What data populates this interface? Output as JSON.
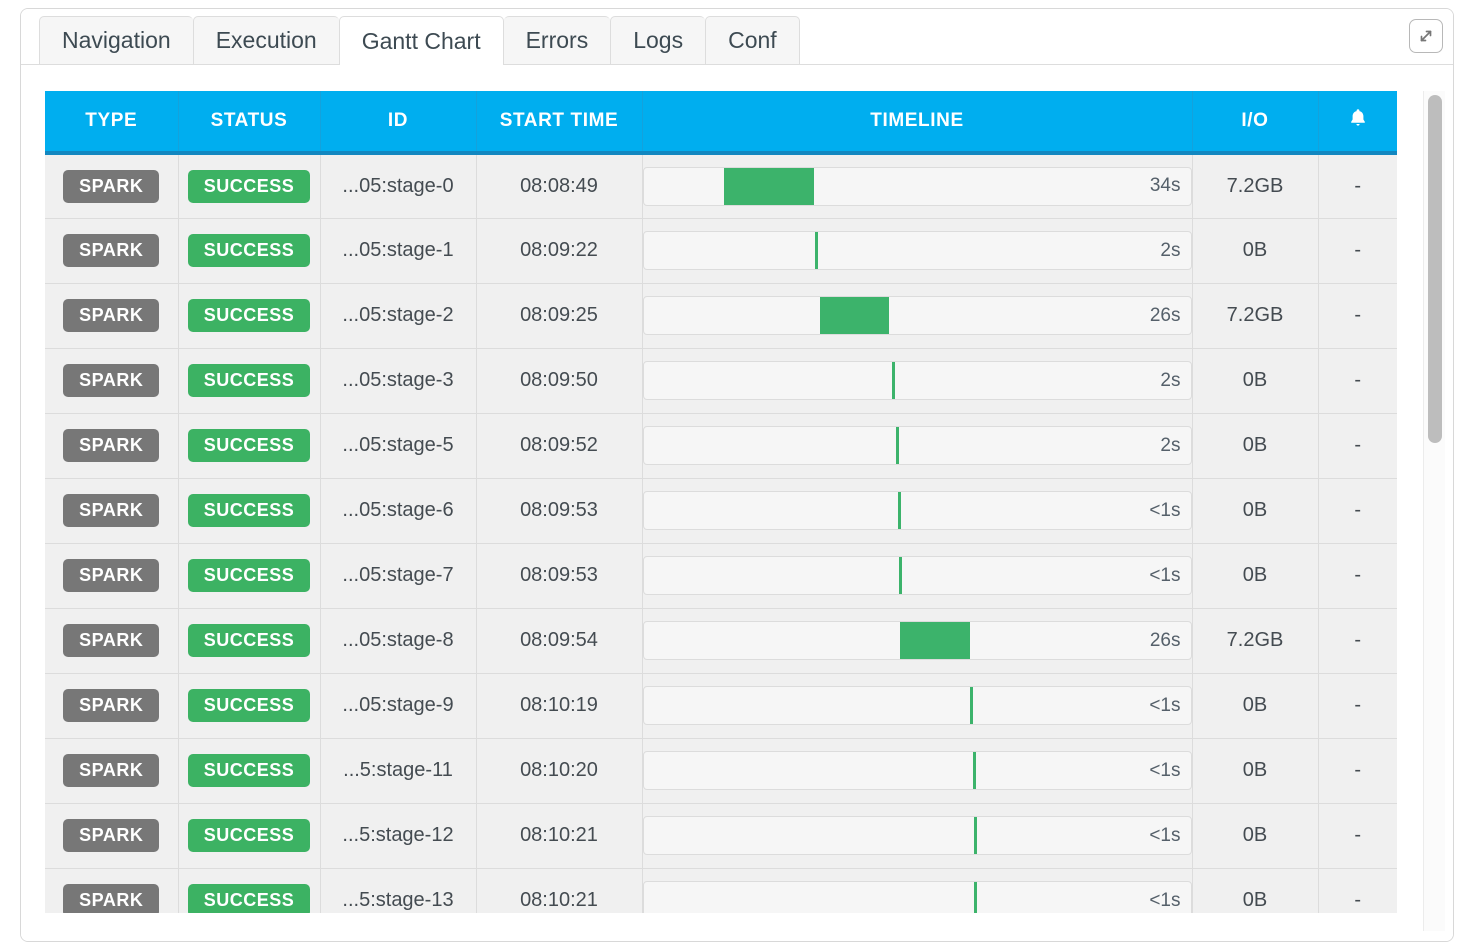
{
  "window": {
    "expand_button_label": "expand",
    "expand_icon": "resize-diagonal-icon"
  },
  "tabs": [
    {
      "label": "Navigation",
      "active": false
    },
    {
      "label": "Execution",
      "active": false
    },
    {
      "label": "Gantt Chart",
      "active": true
    },
    {
      "label": "Errors",
      "active": false
    },
    {
      "label": "Logs",
      "active": false
    },
    {
      "label": "Conf",
      "active": false
    }
  ],
  "table": {
    "columns": [
      {
        "label": "TYPE",
        "key": "type"
      },
      {
        "label": "STATUS",
        "key": "status"
      },
      {
        "label": "ID",
        "key": "id"
      },
      {
        "label": "START TIME",
        "key": "start"
      },
      {
        "label": "TIMELINE",
        "key": "timeline"
      },
      {
        "label": "I/O",
        "key": "io"
      },
      {
        "label": "",
        "key": "alert",
        "icon": "bell-icon"
      }
    ],
    "colors": {
      "header_bg": "#00aeef",
      "header_border": "#1287c0",
      "type_badge": "#777777",
      "status_badge": "#3cb263",
      "bar": "#3cb36b",
      "row_bg": "#f0f0f0",
      "track_bg": "#f6f6f6"
    },
    "rows": [
      {
        "type": "SPARK",
        "status": "SUCCESS",
        "id": "...05:stage-0",
        "start": "08:08:49",
        "duration": "34s",
        "bar_left_pct": 14.7,
        "bar_width_pct": 16.4,
        "io": "7.2GB",
        "alert": "-"
      },
      {
        "type": "SPARK",
        "status": "SUCCESS",
        "id": "...05:stage-1",
        "start": "08:09:22",
        "duration": "2s",
        "bar_left_pct": 31.3,
        "bar_width_pct": 0.55,
        "io": "0B",
        "alert": "-"
      },
      {
        "type": "SPARK",
        "status": "SUCCESS",
        "id": "...05:stage-2",
        "start": "08:09:25",
        "duration": "26s",
        "bar_left_pct": 32.2,
        "bar_width_pct": 12.7,
        "io": "7.2GB",
        "alert": "-"
      },
      {
        "type": "SPARK",
        "status": "SUCCESS",
        "id": "...05:stage-3",
        "start": "08:09:50",
        "duration": "2s",
        "bar_left_pct": 45.4,
        "bar_width_pct": 0.55,
        "io": "0B",
        "alert": "-"
      },
      {
        "type": "SPARK",
        "status": "SUCCESS",
        "id": "...05:stage-5",
        "start": "08:09:52",
        "duration": "2s",
        "bar_left_pct": 46.1,
        "bar_width_pct": 0.55,
        "io": "0B",
        "alert": "-"
      },
      {
        "type": "SPARK",
        "status": "SUCCESS",
        "id": "...05:stage-6",
        "start": "08:09:53",
        "duration": "<1s",
        "bar_left_pct": 46.5,
        "bar_width_pct": 0.5,
        "io": "0B",
        "alert": "-"
      },
      {
        "type": "SPARK",
        "status": "SUCCESS",
        "id": "...05:stage-7",
        "start": "08:09:53",
        "duration": "<1s",
        "bar_left_pct": 46.8,
        "bar_width_pct": 0.5,
        "io": "0B",
        "alert": "-"
      },
      {
        "type": "SPARK",
        "status": "SUCCESS",
        "id": "...05:stage-8",
        "start": "08:09:54",
        "duration": "26s",
        "bar_left_pct": 46.9,
        "bar_width_pct": 12.7,
        "io": "7.2GB",
        "alert": "-"
      },
      {
        "type": "SPARK",
        "status": "SUCCESS",
        "id": "...05:stage-9",
        "start": "08:10:19",
        "duration": "<1s",
        "bar_left_pct": 59.7,
        "bar_width_pct": 0.5,
        "io": "0B",
        "alert": "-"
      },
      {
        "type": "SPARK",
        "status": "SUCCESS",
        "id": "...5:stage-11",
        "start": "08:10:20",
        "duration": "<1s",
        "bar_left_pct": 60.3,
        "bar_width_pct": 0.5,
        "io": "0B",
        "alert": "-"
      },
      {
        "type": "SPARK",
        "status": "SUCCESS",
        "id": "...5:stage-12",
        "start": "08:10:21",
        "duration": "<1s",
        "bar_left_pct": 60.5,
        "bar_width_pct": 0.5,
        "io": "0B",
        "alert": "-"
      },
      {
        "type": "SPARK",
        "status": "SUCCESS",
        "id": "...5:stage-13",
        "start": "08:10:21",
        "duration": "<1s",
        "bar_left_pct": 60.4,
        "bar_width_pct": 0.5,
        "io": "0B",
        "alert": "-"
      }
    ]
  },
  "chart_data": {
    "type": "bar",
    "title": "TIMELINE",
    "xlabel": "",
    "ylabel": "",
    "categories": [
      "...05:stage-0",
      "...05:stage-1",
      "...05:stage-2",
      "...05:stage-3",
      "...05:stage-5",
      "...05:stage-6",
      "...05:stage-7",
      "...05:stage-8",
      "...05:stage-9",
      "...5:stage-11",
      "...5:stage-12",
      "...5:stage-13"
    ],
    "start_times": [
      "08:08:49",
      "08:09:22",
      "08:09:25",
      "08:09:50",
      "08:09:52",
      "08:09:53",
      "08:09:53",
      "08:09:54",
      "08:10:19",
      "08:10:20",
      "08:10:21",
      "08:10:21"
    ],
    "durations_label": [
      "34s",
      "2s",
      "26s",
      "2s",
      "2s",
      "<1s",
      "<1s",
      "26s",
      "<1s",
      "<1s",
      "<1s",
      "<1s"
    ],
    "values": [
      34,
      2,
      26,
      2,
      2,
      0.5,
      0.5,
      26,
      0.5,
      0.5,
      0.5,
      0.5
    ],
    "io_bytes": [
      "7.2GB",
      "0B",
      "7.2GB",
      "0B",
      "0B",
      "0B",
      "0B",
      "7.2GB",
      "0B",
      "0B",
      "0B",
      "0B"
    ],
    "bar_offsets_pct": [
      14.7,
      31.3,
      32.2,
      45.4,
      46.1,
      46.5,
      46.8,
      46.9,
      59.7,
      60.3,
      60.5,
      60.4
    ],
    "bar_widths_pct": [
      16.4,
      0.55,
      12.7,
      0.55,
      0.55,
      0.5,
      0.5,
      12.7,
      0.5,
      0.5,
      0.5,
      0.5
    ],
    "grid": false,
    "legend": "none"
  },
  "scroll": {
    "thumb_top_pct": 0,
    "thumb_height_pct": 41
  }
}
